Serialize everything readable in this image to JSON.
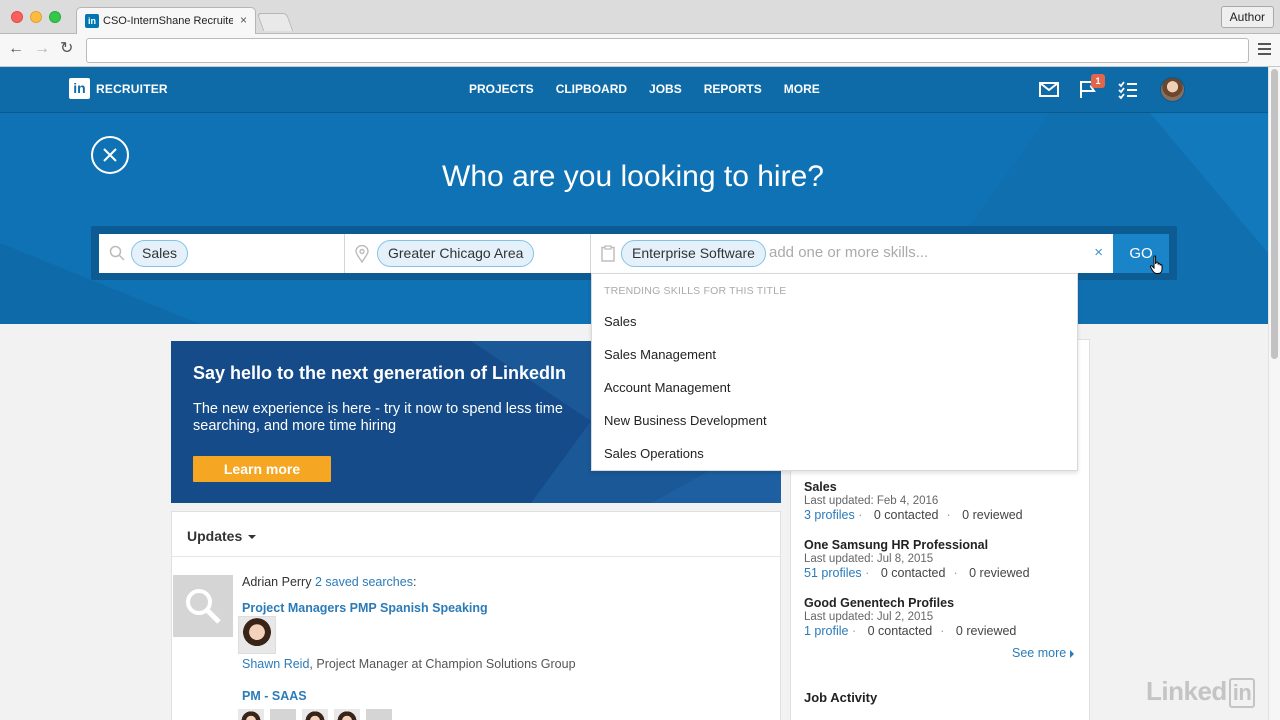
{
  "browser": {
    "tab_title": "CSO-InternShane Recruiter",
    "tab_close": "×",
    "favicon_text": "in",
    "author_button": "Author",
    "url": ""
  },
  "header": {
    "logo_text": "in",
    "product": "RECRUITER",
    "nav": [
      "PROJECTS",
      "CLIPBOARD",
      "JOBS",
      "REPORTS",
      "MORE"
    ],
    "notification_count": "1",
    "brand_color": "#0e6ba8"
  },
  "hero": {
    "title": "Who are you looking to hire?"
  },
  "search": {
    "title_pill": "Sales",
    "location_pill": "Greater Chicago Area",
    "skill_pill": "Enterprise Software",
    "skills_placeholder": "add one or more skills...",
    "clear": "×",
    "go_label": "GO"
  },
  "dropdown": {
    "heading": "TRENDING SKILLS FOR THIS TITLE",
    "items": [
      "Sales",
      "Sales Management",
      "Account Management",
      "New Business Development",
      "Sales Operations"
    ]
  },
  "promo": {
    "title": "Say hello to the next generation of LinkedIn",
    "body": "The new experience is here - try it now to spend less time searching, and more time hiring",
    "button": "Learn more",
    "button_color": "#f5a623"
  },
  "updates": {
    "heading": "Updates",
    "actor": "Adrian Perry",
    "saved_searches_link": "2 saved searches",
    "saved_searches_suffix": ":",
    "search1": "Project Managers PMP Spanish Speaking",
    "person_name": "Shawn Reid",
    "person_title": ", Project Manager at Champion Solutions Group",
    "search2": "PM - SAAS"
  },
  "projects": [
    {
      "name": "Sales",
      "updated": "Last updated: Feb 4, 2016",
      "profiles": "3 profiles",
      "contacted": "0 contacted",
      "reviewed": "0 reviewed"
    },
    {
      "name": "One Samsung HR Professional",
      "updated": "Last updated: Jul 8, 2015",
      "profiles": "51 profiles",
      "contacted": "0 contacted",
      "reviewed": "0 reviewed"
    },
    {
      "name": "Good Genentech Profiles",
      "updated": "Last updated: Jul 2, 2015",
      "profiles": "1 profile",
      "contacted": "0 contacted",
      "reviewed": "0 reviewed"
    }
  ],
  "see_more": "See more",
  "job_activity": "Job Activity",
  "watermark": {
    "text": "Linked",
    "box": "in"
  }
}
